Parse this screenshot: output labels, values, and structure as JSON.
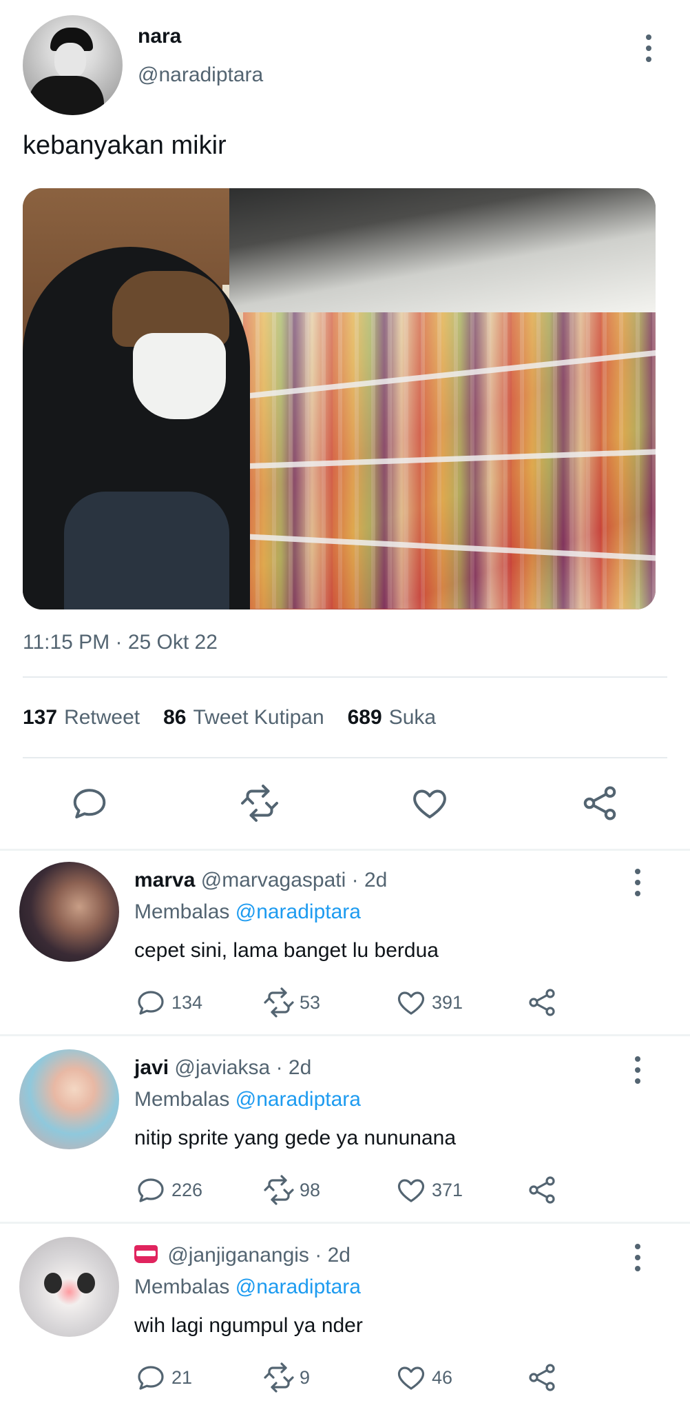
{
  "tweet": {
    "display_name": "nara",
    "handle": "@naradiptara",
    "text": "kebanyakan mikir",
    "timestamp": "11:15 PM · 25 Okt 22",
    "stats": [
      {
        "count": "137",
        "label": "Retweet"
      },
      {
        "count": "86",
        "label": "Tweet Kutipan"
      },
      {
        "count": "689",
        "label": "Suka"
      }
    ],
    "icons": [
      "reply-icon",
      "retweet-icon",
      "like-icon",
      "share-icon"
    ]
  },
  "replies": [
    {
      "name": "marva",
      "handle": "@marvagaspati",
      "age": "· 2d",
      "replying_label": "Membalas",
      "mention": "@naradiptara",
      "text": "cepet sini, lama banget lu berdua",
      "replies": "134",
      "retweets": "53",
      "likes": "391"
    },
    {
      "name": "javi",
      "handle": "@javiaksa",
      "age": "· 2d",
      "replying_label": "Membalas",
      "mention": "@naradiptara",
      "text": "nitip sprite yang gede ya nununana",
      "replies": "226",
      "retweets": "98",
      "likes": "371"
    },
    {
      "name": "",
      "handle": "@janjiganangis",
      "age": "· 2d",
      "replying_label": "Membalas",
      "mention": "@naradiptara",
      "text": "wih lagi ngumpul ya nder",
      "replies": "21",
      "retweets": "9",
      "likes": "46"
    }
  ],
  "colors": {
    "text": "#0f1419",
    "secondary": "#536471",
    "link": "#1d9bf0",
    "divider": "#e6ebee"
  }
}
